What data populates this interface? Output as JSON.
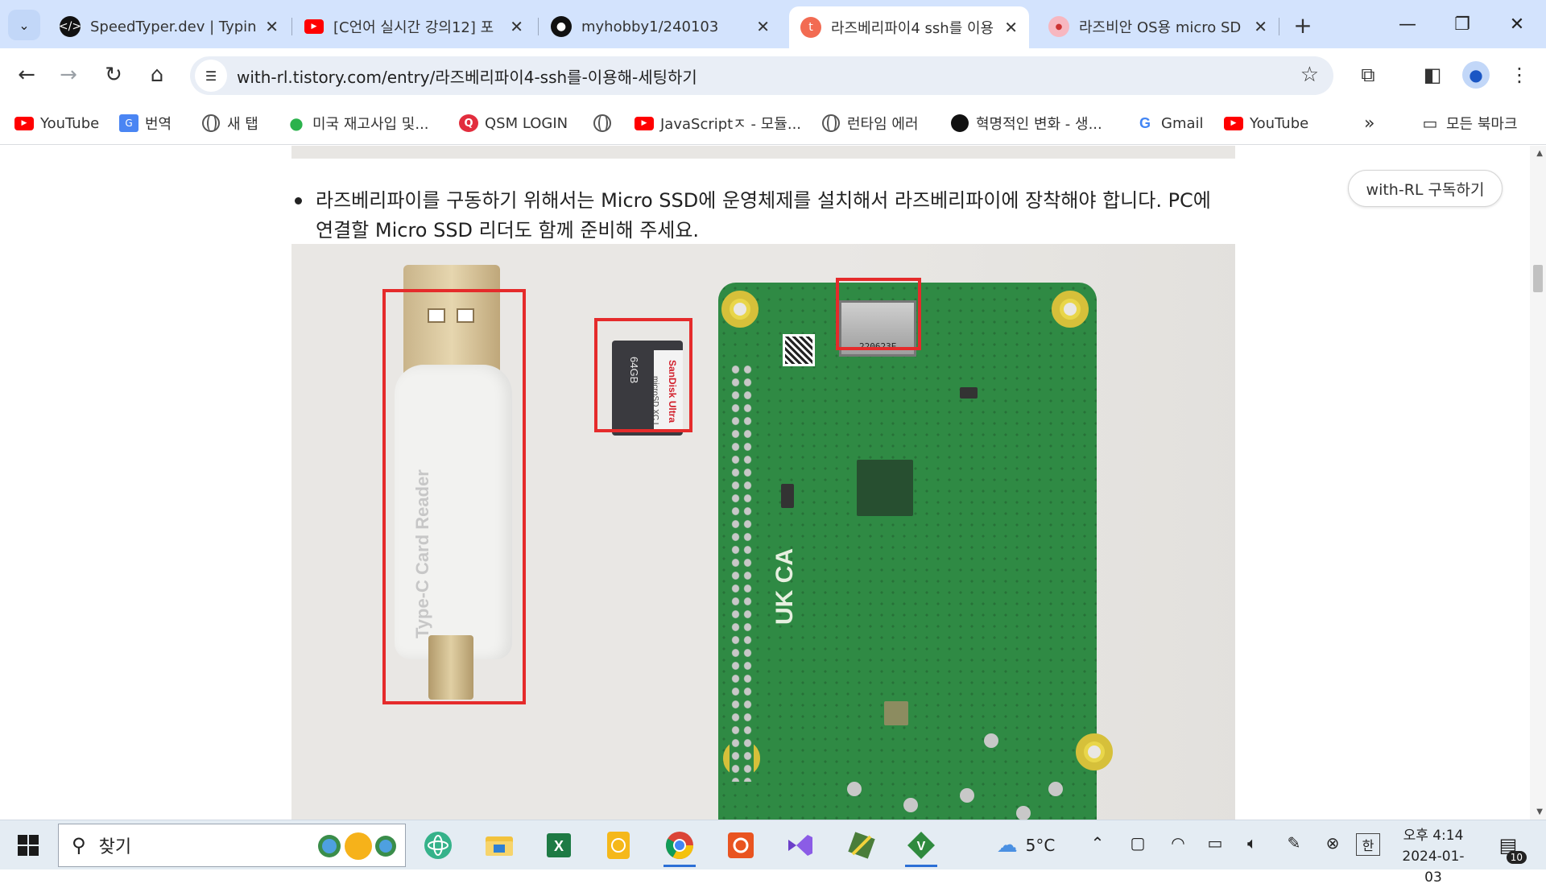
{
  "tabs": [
    {
      "title": "SpeedTyper.dev | Typing",
      "icon": "code-icon"
    },
    {
      "title": "[C언어 실시간 강의12] 포",
      "icon": "youtube-icon"
    },
    {
      "title": "myhobby1/240103",
      "icon": "github-icon"
    },
    {
      "title": "라즈베리파이4 ssh를 이용",
      "icon": "tistory-icon",
      "active": true
    },
    {
      "title": "라즈비안 OS용 micro SD",
      "icon": "blog-icon"
    }
  ],
  "toolbar": {
    "url": "with-rl.tistory.com/entry/라즈베리파이4-ssh를-이용해-세팅하기"
  },
  "bookmarks": [
    {
      "label": "YouTube",
      "icon": "youtube-icon"
    },
    {
      "label": "번역",
      "icon": "translate-icon"
    },
    {
      "label": "새 탭",
      "icon": "globe-icon"
    },
    {
      "label": "미국 재고사입 및...",
      "icon": "leaf-icon"
    },
    {
      "label": "QSM LOGIN",
      "icon": "qsm-icon"
    },
    {
      "label": "",
      "icon": "globe-icon"
    },
    {
      "label": "JavaScriptㅈ - 모듈...",
      "icon": "youtube-icon"
    },
    {
      "label": "런타임 에러",
      "icon": "globe-icon"
    },
    {
      "label": "혁명적인 변화 - 생...",
      "icon": "circle-icon"
    },
    {
      "label": "Gmail",
      "icon": "google-icon"
    },
    {
      "label": "YouTube",
      "icon": "youtube-icon"
    }
  ],
  "bookmarks_more": "»",
  "all_bookmarks": "모든 북마크",
  "content": {
    "bullet_text": "라즈베리파이를 구동하기 위해서는 Micro SSD에 운영체제를 설치해서 라즈베리파이에 장착해야 합니다. PC에 연결할 Micro SSD 리더도 함께 준비해 주세요.",
    "subscribe_label": "with-RL 구독하기",
    "photo": {
      "reader_label": "Type-C Card Reader",
      "sd_capacity": "64GB",
      "sd_brand": "SanDisk Ultra",
      "sd_type": "microSD XC I",
      "pcb_code": "220623E",
      "pcb_mark": "UK CA"
    }
  },
  "taskbar": {
    "search_placeholder": "찾기",
    "weather": "5°C",
    "ime": "한",
    "time": "오후 4:14",
    "date": "2024-01-03",
    "notifications": "10"
  },
  "colors": {
    "tabstrip": "#d3e3fd",
    "highlight_box": "#e52b2b",
    "pcb_green": "#2f8a44"
  }
}
